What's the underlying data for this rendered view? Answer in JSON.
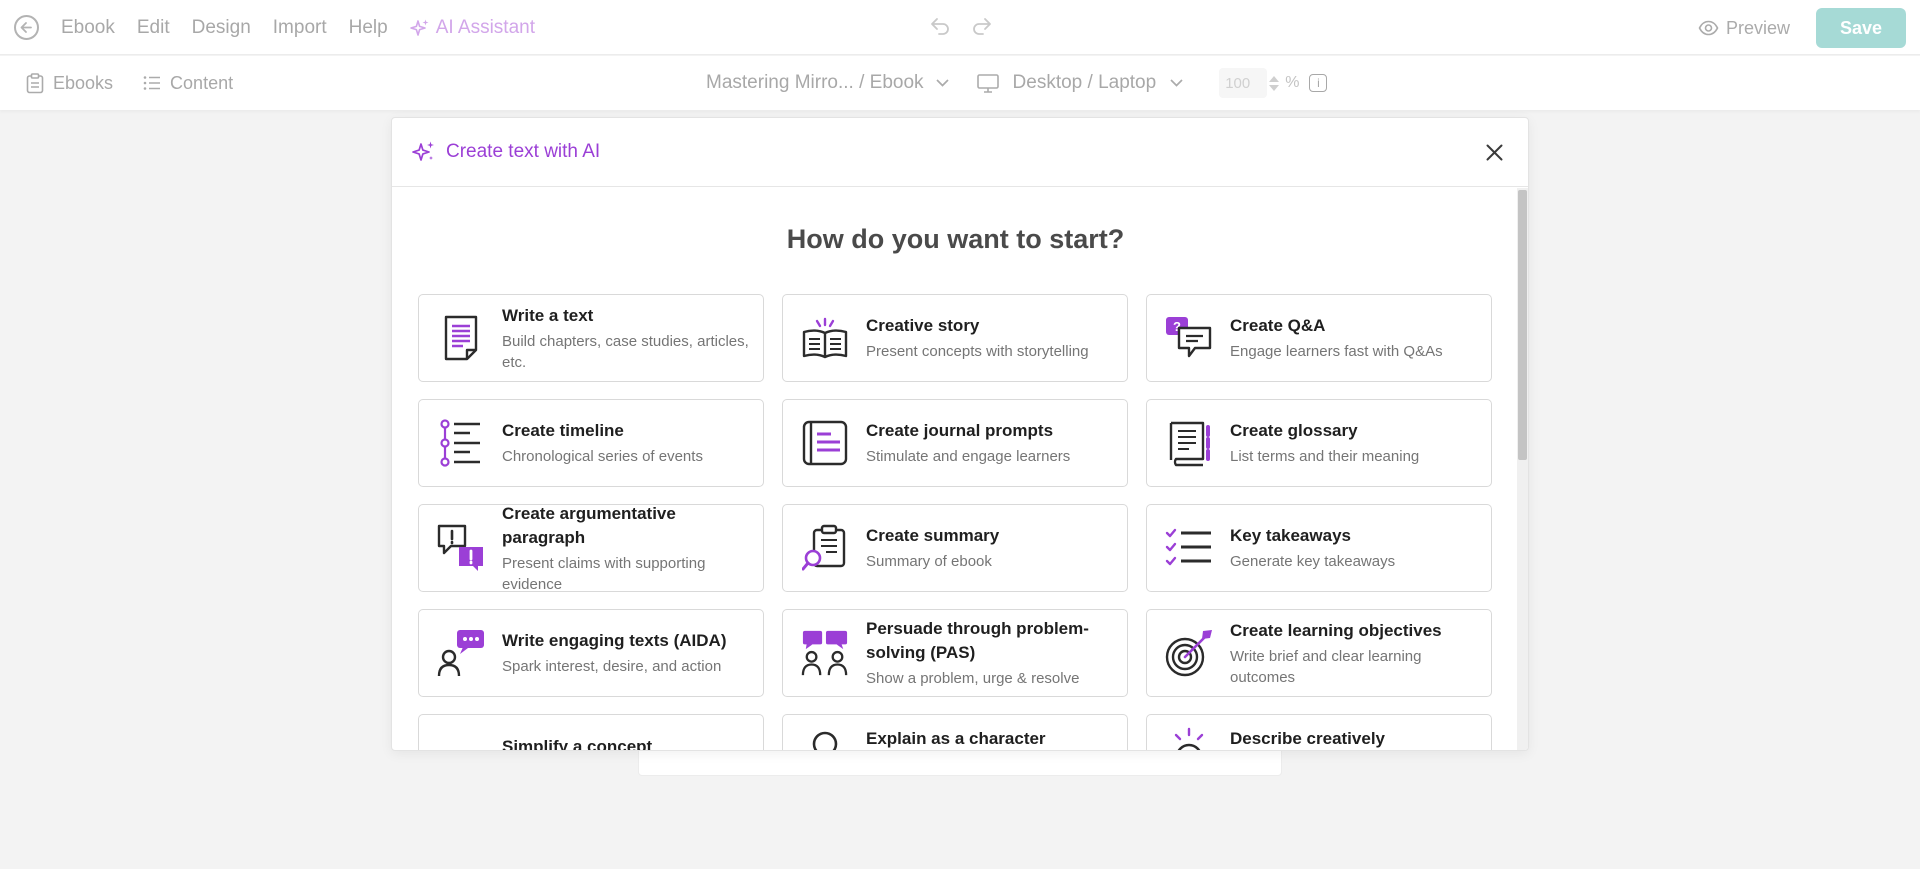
{
  "topbar": {
    "menu": [
      "Ebook",
      "Edit",
      "Design",
      "Import",
      "Help"
    ],
    "ai_assistant": "AI Assistant",
    "preview": "Preview",
    "save": "Save"
  },
  "subbar": {
    "ebooks": "Ebooks",
    "content": "Content",
    "breadcrumb": "Mastering Mirro... / Ebook",
    "device": "Desktop / Laptop",
    "zoom": "100",
    "zoom_unit": "%"
  },
  "modal": {
    "title": "Create text with AI",
    "heading": "How do you want to start?",
    "options": [
      {
        "icon": "document-icon",
        "title": "Write a text",
        "desc": "Build chapters, case studies, articles, etc."
      },
      {
        "icon": "open-book-icon",
        "title": "Creative story",
        "desc": "Present concepts with storytelling"
      },
      {
        "icon": "qa-bubbles-icon",
        "title": "Create Q&A",
        "desc": "Engage learners fast with Q&As"
      },
      {
        "icon": "timeline-icon",
        "title": "Create timeline",
        "desc": "Chronological series of events"
      },
      {
        "icon": "journal-icon",
        "title": "Create journal prompts",
        "desc": "Stimulate and engage learners"
      },
      {
        "icon": "glossary-book-icon",
        "title": "Create glossary",
        "desc": "List terms and their meaning"
      },
      {
        "icon": "argument-bubbles-icon",
        "title": "Create argumentative paragraph",
        "desc": "Present claims with supporting evidence"
      },
      {
        "icon": "clipboard-search-icon",
        "title": "Create summary",
        "desc": "Summary of ebook"
      },
      {
        "icon": "checklist-icon",
        "title": "Key takeaways",
        "desc": "Generate key takeaways"
      },
      {
        "icon": "person-chat-icon",
        "title": "Write engaging texts (AIDA)",
        "desc": "Spark interest, desire, and action"
      },
      {
        "icon": "people-chat-icon",
        "title": "Persuade through problem-solving (PAS)",
        "desc": "Show a problem, urge & resolve"
      },
      {
        "icon": "target-icon",
        "title": "Create learning objectives",
        "desc": "Write brief and clear learning outcomes"
      },
      {
        "icon": "dots-icon",
        "title": "Simplify a concept",
        "desc": ""
      },
      {
        "icon": "character-icon",
        "title": "Explain as a character",
        "desc": ""
      },
      {
        "icon": "sun-icon",
        "title": "Describe creatively",
        "desc": ""
      }
    ]
  },
  "colors": {
    "accent": "#9b3fd6",
    "save": "#a6dad6"
  }
}
